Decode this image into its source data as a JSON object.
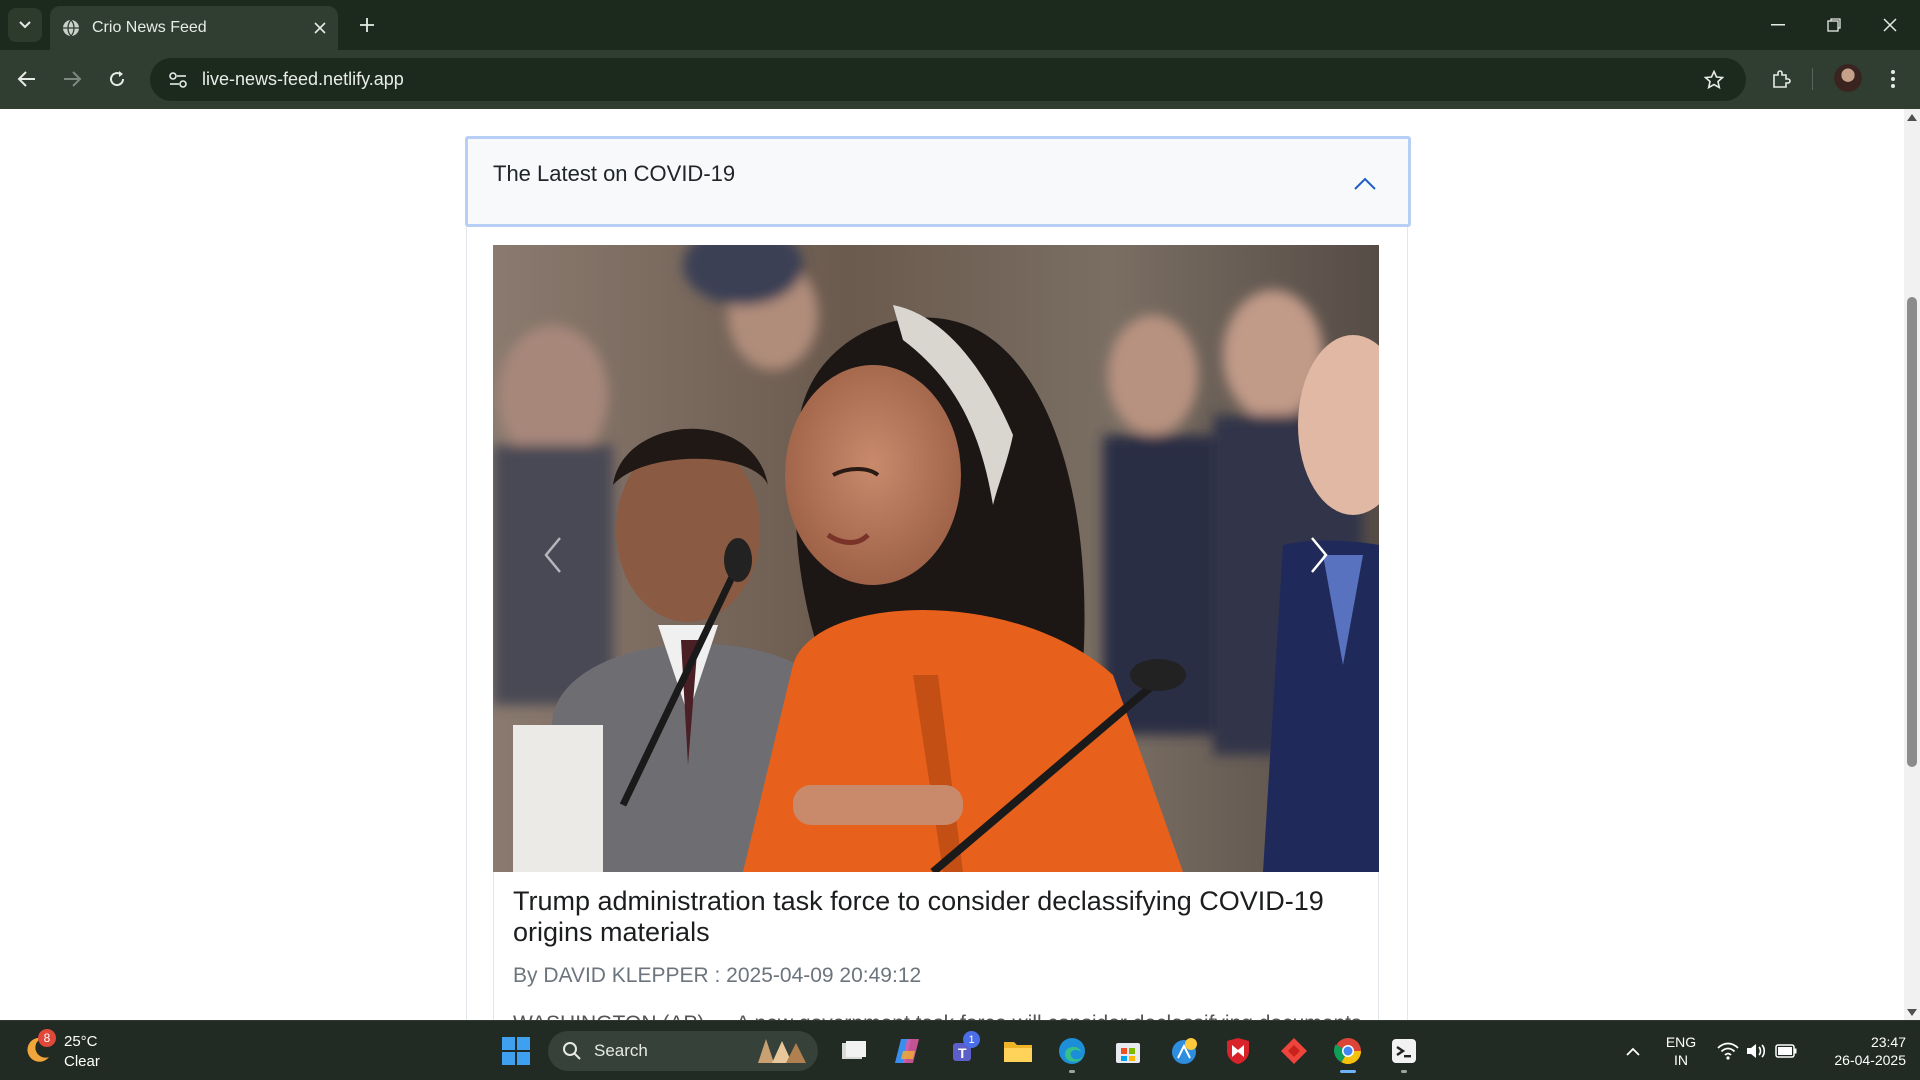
{
  "browser": {
    "tab_title": "Crio News Feed",
    "url": "live-news-feed.netlify.app"
  },
  "accordion": {
    "title": "The Latest on COVID-19",
    "expanded": true
  },
  "article": {
    "headline": "Trump administration task force to consider declassifying COVID-19 origins materials",
    "byline": "By DAVID KLEPPER : 2025-04-09 20:49:12",
    "snippet": "WASHINGTON (AP) — A new government task force will consider declassifying documents"
  },
  "taskbar": {
    "weather_temp": "25°C",
    "weather_desc": "Clear",
    "weather_badge": "8",
    "search_label": "Search",
    "teams_badge": "1",
    "lang_line1": "ENG",
    "lang_line2": "IN",
    "time": "23:47",
    "date": "26-04-2025"
  },
  "colors": {
    "chrome_dark": "#1c2a1d",
    "chrome_mid": "#2f3e30",
    "accordion_focus_border": "#b8cff5",
    "accent_orange": "#e8611c"
  },
  "icons": [
    "tab-dropdown-icon",
    "globe-icon",
    "close-icon",
    "plus-icon",
    "minimize-icon",
    "restore-icon",
    "back-icon",
    "forward-icon",
    "reload-icon",
    "site-info-icon",
    "star-icon",
    "extensions-icon",
    "kebab-menu-icon",
    "chevron-up-icon",
    "carousel-prev-icon",
    "carousel-next-icon",
    "windows-start-icon",
    "search-icon",
    "task-view-icon",
    "copilot-icon",
    "teams-icon",
    "file-explorer-icon",
    "edge-icon",
    "store-icon",
    "weather-app-icon",
    "mcafee-icon",
    "anydesk-icon",
    "chrome-icon",
    "terminal-icon",
    "wifi-icon",
    "volume-icon",
    "battery-icon"
  ]
}
